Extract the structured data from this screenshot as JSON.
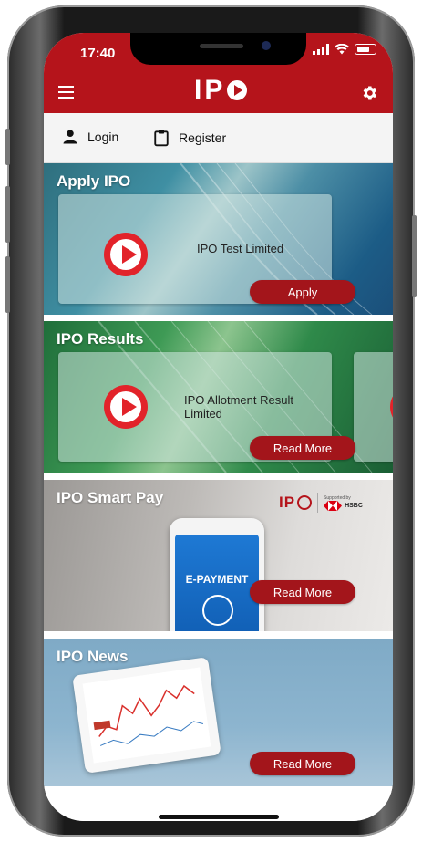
{
  "status_bar": {
    "time": "17:40"
  },
  "app_bar": {
    "logo_text": "IP"
  },
  "auth": {
    "login_label": "Login",
    "register_label": "Register"
  },
  "sections": {
    "apply": {
      "title": "Apply IPO",
      "card_text": "IPO Test Limited",
      "button": "Apply"
    },
    "results": {
      "title": "IPO Results",
      "card_text": "IPO Allotment Result Limited",
      "button": "Read More"
    },
    "smart_pay": {
      "title": "IPO Smart Pay",
      "phone_screen_text": "E-PAYMENT",
      "logo_text": "IP",
      "bank_text": "HSBC",
      "bank_small": "Supported by",
      "button": "Read More"
    },
    "news": {
      "title": "IPO News",
      "button": "Read More"
    }
  },
  "colors": {
    "brand_red": "#b5141b",
    "button_red": "#a3151b",
    "play_red": "#e2232a"
  },
  "icons": [
    "menu-icon",
    "gear-icon",
    "person-icon",
    "clipboard-icon",
    "play-icon"
  ]
}
